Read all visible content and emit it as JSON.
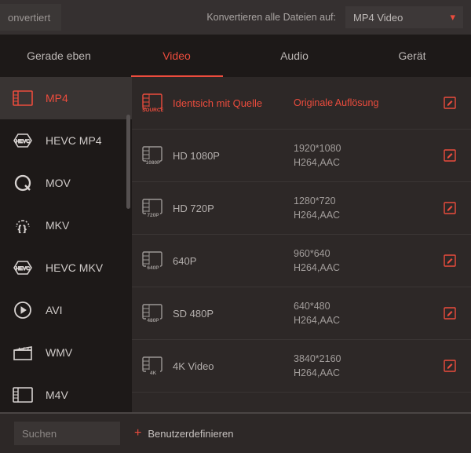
{
  "topbar": {
    "converted_label": "onvertiert",
    "convert_all_label": "Konvertieren alle Dateien auf:",
    "target_format": "MP4 Video"
  },
  "tabs": [
    {
      "id": "recent",
      "label": "Gerade eben"
    },
    {
      "id": "video",
      "label": "Video"
    },
    {
      "id": "audio",
      "label": "Audio"
    },
    {
      "id": "device",
      "label": "Gerät"
    }
  ],
  "active_tab": "video",
  "formats": [
    {
      "id": "mp4",
      "label": "MP4",
      "icon": "film"
    },
    {
      "id": "hevc-mp4",
      "label": "HEVC MP4",
      "icon": "hevc"
    },
    {
      "id": "mov",
      "label": "MOV",
      "icon": "q"
    },
    {
      "id": "mkv",
      "label": "MKV",
      "icon": "mkv"
    },
    {
      "id": "hevc-mkv",
      "label": "HEVC MKV",
      "icon": "hevc"
    },
    {
      "id": "avi",
      "label": "AVI",
      "icon": "play"
    },
    {
      "id": "wmv",
      "label": "WMV",
      "icon": "clap"
    },
    {
      "id": "m4v",
      "label": "M4V",
      "icon": "film"
    }
  ],
  "selected_format": "mp4",
  "presets": [
    {
      "id": "source",
      "thumb": "source",
      "title": "Identsich mit Quelle",
      "line1": "Originale Auflösung",
      "line2": ""
    },
    {
      "id": "1080p",
      "thumb": "1080p",
      "title": "HD 1080P",
      "line1": "1920*1080",
      "line2": "H264,AAC"
    },
    {
      "id": "720p",
      "thumb": "720p",
      "title": "HD 720P",
      "line1": "1280*720",
      "line2": "H264,AAC"
    },
    {
      "id": "640p",
      "thumb": "640p",
      "title": "640P",
      "line1": "960*640",
      "line2": "H264,AAC"
    },
    {
      "id": "480p",
      "thumb": "480p",
      "title": "SD 480P",
      "line1": "640*480",
      "line2": "H264,AAC"
    },
    {
      "id": "4k",
      "thumb": "4k",
      "title": "4K Video",
      "line1": "3840*2160",
      "line2": "H264,AAC"
    }
  ],
  "selected_preset": "source",
  "search_placeholder": "Suchen",
  "custom_label": "Benutzerdefinieren",
  "colors": {
    "accent": "#ec4c3d"
  }
}
